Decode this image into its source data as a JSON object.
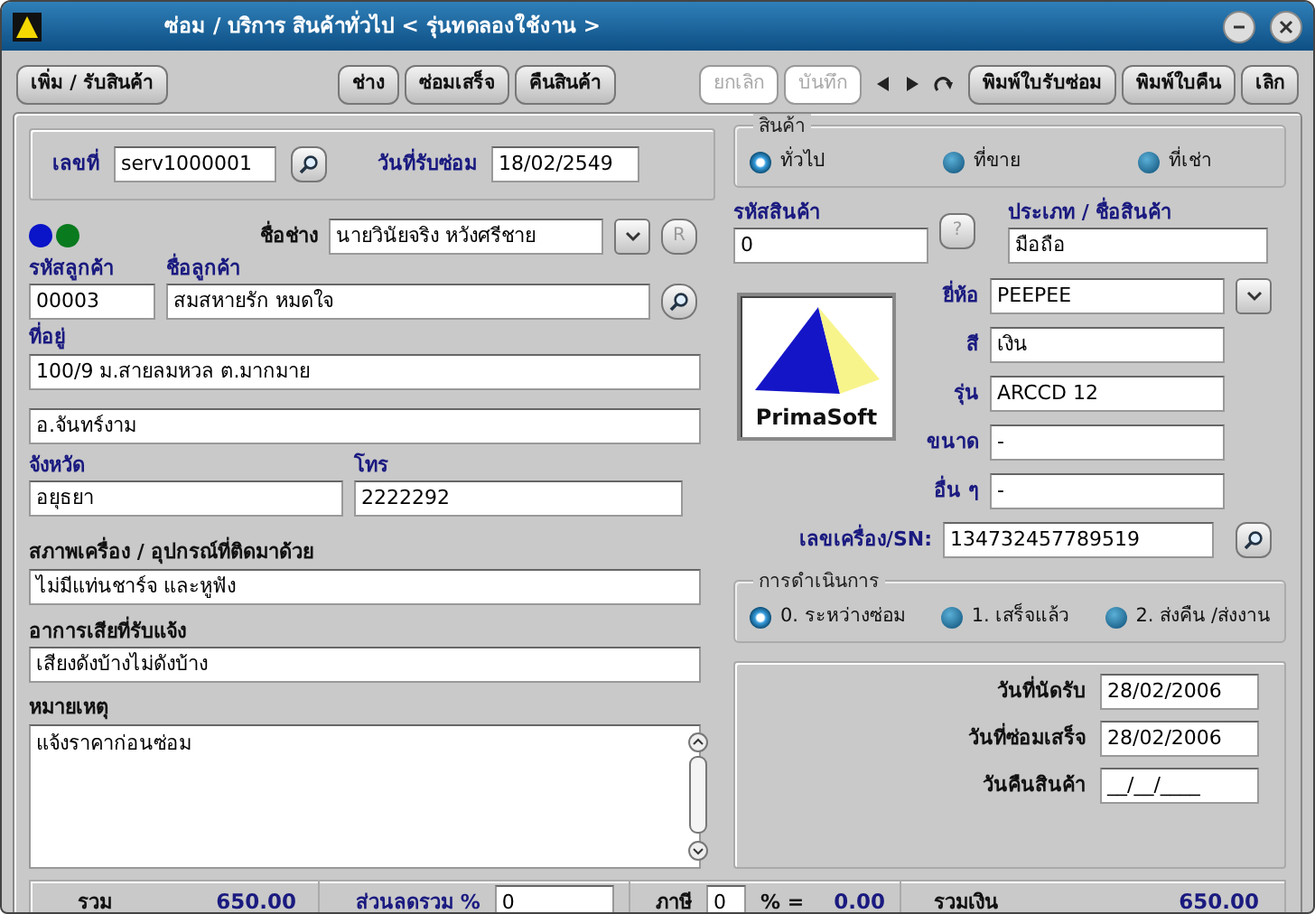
{
  "window": {
    "title": "ซ่อม / บริการ สินค้าทั่วไป < รุ่นทดลองใช้งาน >"
  },
  "toolbar": {
    "groups": [
      [
        {
          "label": "เพิ่ม / รับสินค้า",
          "disabled": false
        }
      ],
      [
        {
          "label": "ช่าง",
          "disabled": false
        },
        {
          "label": "ซ่อมเสร็จ",
          "disabled": false
        },
        {
          "label": "คืนสินค้า",
          "disabled": false
        }
      ],
      [
        {
          "label": "ยกเลิก",
          "disabled": true
        },
        {
          "label": "บันทึก",
          "disabled": true
        }
      ],
      [
        {
          "label": "พิมพ์ใบรับซ่อม",
          "disabled": false
        },
        {
          "label": "พิมพ์ใบคืน",
          "disabled": false
        },
        {
          "label": "เลิก",
          "disabled": false
        }
      ]
    ]
  },
  "job": {
    "number_label": "เลขที่",
    "number": "serv1000001",
    "date_label": "วันที่รับซ่อม",
    "date": "18/02/2549"
  },
  "status_dots": [
    {
      "color": "#0a14c8"
    },
    {
      "color": "#0a7a1e"
    }
  ],
  "technician": {
    "label": "ชื่อช่าง",
    "value": "นายวินัยจริง หวังศรีชาย",
    "button": "R"
  },
  "customer": {
    "code_label": "รหัสลูกค้า",
    "code": "00003",
    "name_label": "ชื่อลูกค้า",
    "name": "สมสหายรัก หมดใจ",
    "address_label": "ที่อยู่",
    "address_lines": [
      "100/9 ม.สายลมหวล ต.มากมาย",
      "อ.จันทร์งาม"
    ],
    "province_label": "จังหวัด",
    "province": "อยุธยา",
    "phone_label": "โทร",
    "phone": "2222292"
  },
  "condition": {
    "label": "สภาพเครื่อง / อุปกรณ์ที่ติดมาด้วย",
    "value": "ไม่มีแท่นชาร์จ และหูฟัง"
  },
  "symptom": {
    "label": "อาการเสียที่รับแจ้ง",
    "value": "เสียงดังบ้างไม่ดังบ้าง"
  },
  "note": {
    "label": "หมายเหตุ",
    "value": "แจ้งราคาก่อนซ่อม"
  },
  "product_type": {
    "legend": "สินค้า",
    "options": [
      {
        "label": "ทั่วไป",
        "selected": true
      },
      {
        "label": "ที่ขาย",
        "selected": false
      },
      {
        "label": "ที่เช่า",
        "selected": false
      }
    ]
  },
  "product": {
    "code_label": "รหัสสินค้า",
    "code": "0",
    "help_button": "?",
    "name_label": "ประเภท / ชื่อสินค้า",
    "name": "มือถือ",
    "logo_text": "PrimaSoft",
    "fields": [
      {
        "label": "ยี่ห้อ",
        "value": "PEEPEE",
        "kind": "dropdown"
      },
      {
        "label": "สี",
        "value": "เงิน",
        "kind": "text"
      },
      {
        "label": "รุ่น",
        "value": "ARCCD 12",
        "kind": "text"
      },
      {
        "label": "ขนาด",
        "value": "-",
        "kind": "text"
      },
      {
        "label": "อื่น ๆ",
        "value": "-",
        "kind": "text"
      },
      {
        "label": "เลขเครื่อง/SN:",
        "value": "134732457789519",
        "kind": "search"
      }
    ]
  },
  "process": {
    "legend": "การดำเนินการ",
    "options": [
      {
        "label": "0. ระหว่างซ่อม",
        "selected": true
      },
      {
        "label": "1. เสร็จแล้ว",
        "selected": false
      },
      {
        "label": "2. ส่งคืน /ส่งงาน",
        "selected": false
      }
    ]
  },
  "dates": [
    {
      "label": "วันที่นัดรับ",
      "value": "28/02/2006"
    },
    {
      "label": "วันที่ซ่อมเสร็จ",
      "value": "28/02/2006"
    },
    {
      "label": "วันคืนสินค้า",
      "value": "__/__/____"
    }
  ],
  "totals": {
    "subtotal_label": "รวม",
    "subtotal": "650.00",
    "discount_label": "ส่วนลดรวม %",
    "discount": "0",
    "tax_label": "ภาษี",
    "tax": "0",
    "tax_equals": "% =",
    "tax_amount": "0.00",
    "total_label": "รวมเงิน",
    "total": "650.00"
  }
}
